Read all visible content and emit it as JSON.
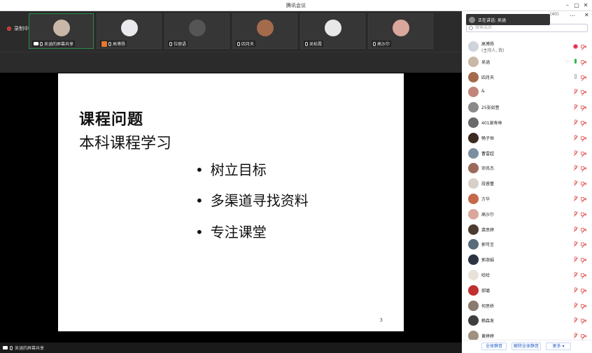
{
  "window": {
    "title": "腾讯会议"
  },
  "recording": {
    "label": "录制中"
  },
  "thumbnails": [
    {
      "name": "吴涵的屏幕共享",
      "color": "#c9b8a8",
      "active": true,
      "screen": true
    },
    {
      "name": "高博扬",
      "color": "#e9e9ee",
      "active": false,
      "host": true
    },
    {
      "name": "位丽语",
      "color": "#555555",
      "active": false
    },
    {
      "name": "四月天",
      "color": "#a46a4c",
      "active": false
    },
    {
      "name": "吴松霞",
      "color": "#e8e8e8",
      "active": false
    },
    {
      "name": "高沙尔",
      "color": "#d9a79c",
      "active": false
    }
  ],
  "slide": {
    "title": "课程问题",
    "subtitle": "本科课程学习",
    "bullets": [
      "树立目标",
      "多渠道寻找资料",
      "专注课堂"
    ],
    "page": "3"
  },
  "bottom": {
    "share_label": "吴涵的屏幕共享"
  },
  "panel": {
    "speaking": "正在讲话: 吴涵",
    "count": "(40)",
    "search_placeholder": "搜索成员",
    "participants": [
      {
        "name": "高博扬",
        "role": "(主持人, 我)",
        "color": "#cfd3dc",
        "mic": "rec",
        "cam": "off"
      },
      {
        "name": "吴涵",
        "color": "#c9b8a8",
        "mic": "green",
        "cam": "off",
        "heart": true
      },
      {
        "name": "四月天",
        "color": "#a46a4c",
        "mic": "grey",
        "cam": "off"
      },
      {
        "name": "&",
        "color": "#c0867a",
        "mic": "off",
        "cam": "off"
      },
      {
        "name": "25张如萱",
        "color": "#8a8a8a",
        "mic": "off",
        "cam": "off"
      },
      {
        "name": "401谢寿林",
        "color": "#6a6a6a",
        "mic": "off",
        "cam": "off"
      },
      {
        "name": "畅子恒",
        "color": "#3b2a22",
        "mic": "off",
        "cam": "off"
      },
      {
        "name": "曹雷超",
        "color": "#7b8fa0",
        "mic": "off",
        "cam": "off"
      },
      {
        "name": "邓伟杰",
        "color": "#9a6b5a",
        "mic": "off",
        "cam": "off"
      },
      {
        "name": "段睿蕾",
        "color": "#d8d0c8",
        "mic": "off",
        "cam": "off"
      },
      {
        "name": "方华",
        "color": "#c46a4a",
        "mic": "off",
        "cam": "off"
      },
      {
        "name": "高沙尔",
        "color": "#d9a79c",
        "mic": "off",
        "cam": "off"
      },
      {
        "name": "龚思婷",
        "color": "#4e3b30",
        "mic": "off",
        "cam": "off"
      },
      {
        "name": "郭可言",
        "color": "#5a6b7a",
        "mic": "off",
        "cam": "off"
      },
      {
        "name": "郭淑娟",
        "color": "#2b3440",
        "mic": "off",
        "cam": "off"
      },
      {
        "name": "哈哈",
        "color": "#e8e3d8",
        "mic": "off",
        "cam": "off"
      },
      {
        "name": "郝璐",
        "color": "#c03030",
        "mic": "off",
        "cam": "off"
      },
      {
        "name": "何思桥",
        "color": "#8a7a70",
        "mic": "off",
        "cam": "off"
      },
      {
        "name": "赖森发",
        "color": "#3e3e3e",
        "mic": "off",
        "cam": "off"
      },
      {
        "name": "黄婷婷",
        "color": "#a09080",
        "mic": "off",
        "cam": "off"
      }
    ],
    "buttons": {
      "mute_all": "全体静音",
      "unmute_all": "解除全体静音",
      "more": "更多 ▾"
    }
  }
}
